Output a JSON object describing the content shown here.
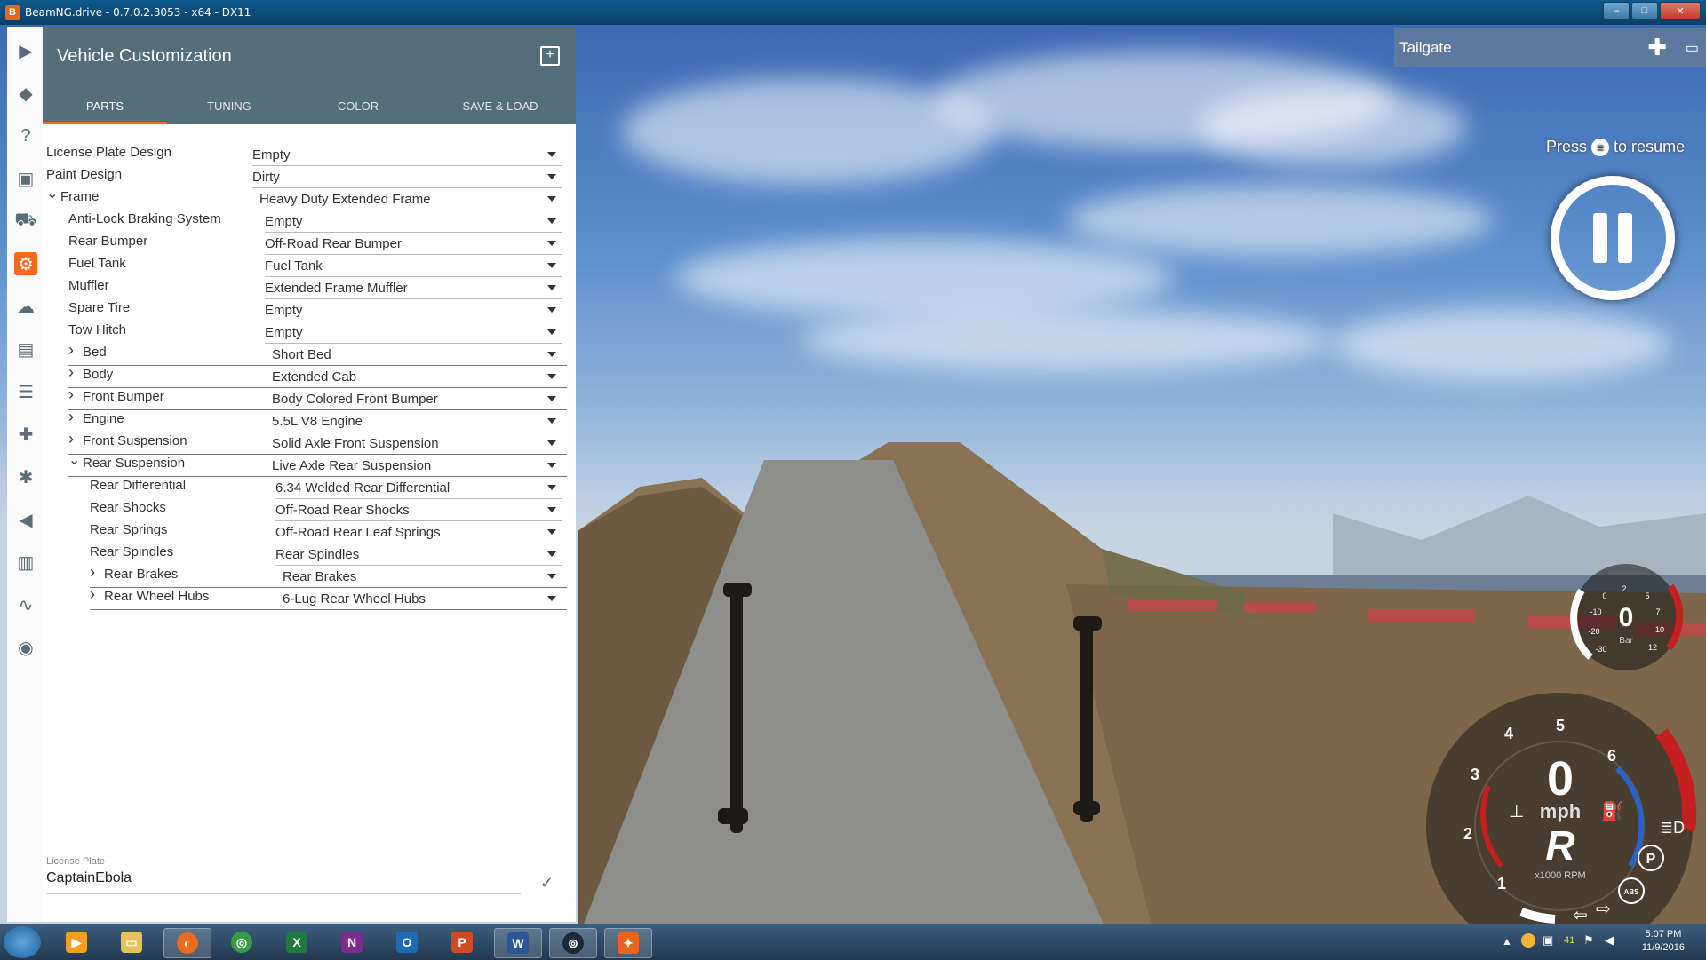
{
  "window": {
    "title": "BeamNG.drive - 0.7.0.2.3053 - x64 - DX11",
    "buttons": [
      "–",
      "□",
      "✕"
    ]
  },
  "panel": {
    "title": "Vehicle Customization",
    "tabs": [
      "PARTS",
      "TUNING",
      "COLOR",
      "SAVE & LOAD"
    ],
    "active_tab": "PARTS",
    "rows": [
      {
        "label": "License Plate Design",
        "value": "Empty",
        "indent": 0
      },
      {
        "label": "Paint Design",
        "value": "Dirty",
        "indent": 0
      },
      {
        "label": "Frame",
        "value": "Heavy Duty Extended Frame",
        "indent": 0,
        "expanded": true
      },
      {
        "label": "Anti-Lock Braking System",
        "value": "Empty",
        "indent": 1
      },
      {
        "label": "Rear Bumper",
        "value": "Off-Road Rear Bumper",
        "indent": 1
      },
      {
        "label": "Fuel Tank",
        "value": "Fuel Tank",
        "indent": 1
      },
      {
        "label": "Muffler",
        "value": "Extended Frame Muffler",
        "indent": 1
      },
      {
        "label": "Spare Tire",
        "value": "Empty",
        "indent": 1
      },
      {
        "label": "Tow Hitch",
        "value": "Empty",
        "indent": 1
      },
      {
        "label": "Bed",
        "value": "Short Bed",
        "indent": 1,
        "expanded": false
      },
      {
        "label": "Body",
        "value": "Extended Cab",
        "indent": 1,
        "expanded": false
      },
      {
        "label": "Front Bumper",
        "value": "Body Colored Front Bumper",
        "indent": 1,
        "expanded": false
      },
      {
        "label": "Engine",
        "value": "5.5L V8 Engine",
        "indent": 1,
        "expanded": false
      },
      {
        "label": "Front Suspension",
        "value": "Solid Axle Front Suspension",
        "indent": 1,
        "expanded": false
      },
      {
        "label": "Rear Suspension",
        "value": "Live Axle Rear Suspension",
        "indent": 1,
        "expanded": true
      },
      {
        "label": "Rear Differential",
        "value": "6.34 Welded Rear Differential",
        "indent": 2
      },
      {
        "label": "Rear Shocks",
        "value": "Off-Road Rear Shocks",
        "indent": 2
      },
      {
        "label": "Rear Springs",
        "value": "Off-Road Rear Leaf Springs",
        "indent": 2
      },
      {
        "label": "Rear Spindles",
        "value": "Rear Spindles",
        "indent": 2
      },
      {
        "label": "Rear Brakes",
        "value": "Rear Brakes",
        "indent": 2,
        "expanded": false
      },
      {
        "label": "Rear Wheel Hubs",
        "value": "6-Lug Rear Wheel Hubs",
        "indent": 2,
        "expanded": false
      }
    ],
    "license_plate": {
      "label": "License Plate",
      "value": "CaptainEbola"
    }
  },
  "hud": {
    "app_title": "Tailgate",
    "resume_press": "Press",
    "resume_rest": "to resume",
    "boost": {
      "value": "0",
      "unit": "Bar",
      "ticks": [
        "-30",
        "-20",
        "-10",
        "0",
        "2",
        "5",
        "7",
        "10",
        "12"
      ]
    },
    "speed": {
      "value": "0",
      "unit": "mph",
      "gear": "R",
      "rpm_label": "x1000 RPM",
      "rpm_ticks": [
        "1",
        "2",
        "3",
        "4",
        "5",
        "6"
      ]
    },
    "indicators": [
      "P",
      "ABS"
    ]
  },
  "taskbar": {
    "apps": [
      "media-player",
      "explorer",
      "firefox",
      "chrome",
      "excel",
      "onenote",
      "outlook",
      "powerpoint",
      "word",
      "steam",
      "beamng"
    ],
    "tray_badge": "41",
    "time": "5:07 PM",
    "date": "11/9/2016"
  },
  "colors": {
    "accent": "#f26b21",
    "header": "#546e7a"
  }
}
